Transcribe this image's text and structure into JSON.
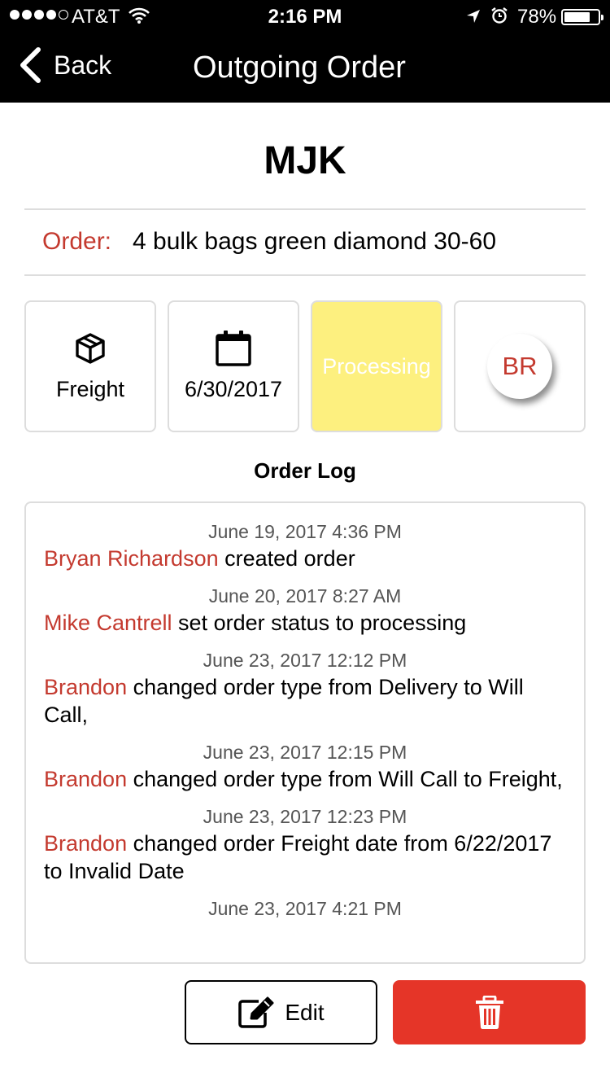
{
  "status_bar": {
    "carrier": "AT&T",
    "time": "2:16 PM",
    "battery": "78%",
    "signal_bars": 4,
    "signal_max": 5,
    "battery_level": 0.78
  },
  "nav": {
    "back_label": "Back",
    "title": "Outgoing Order"
  },
  "order": {
    "customer": "MJK",
    "label": "Order:",
    "description": "4 bulk bags green diamond 30-60"
  },
  "tiles": {
    "type_label": "Freight",
    "type_icon": "package-icon",
    "date": "6/30/2017",
    "date_icon": "calendar-icon",
    "status": "Processing",
    "status_color": "#fdf07f",
    "assignee_initials": "BR"
  },
  "log": {
    "title": "Order Log",
    "entries": [
      {
        "time": "June 19, 2017  4:36 PM",
        "who": "Bryan Richardson",
        "text": " created order"
      },
      {
        "time": "June 20, 2017  8:27 AM",
        "who": "Mike Cantrell",
        "text": " set order status to processing"
      },
      {
        "time": "June 23, 2017  12:12 PM",
        "who": "Brandon",
        "text": " changed order type from Delivery to Will Call,"
      },
      {
        "time": "June 23, 2017  12:15 PM",
        "who": "Brandon",
        "text": " changed order type from Will Call to Freight,"
      },
      {
        "time": "June 23, 2017  12:23 PM",
        "who": "Brandon",
        "text": " changed order Freight date from 6/22/2017 to Invalid Date"
      },
      {
        "time": "June 23, 2017  4:21 PM",
        "who": "",
        "text": ""
      }
    ]
  },
  "actions": {
    "edit_label": "Edit",
    "edit_icon": "edit-icon",
    "delete_icon": "trash-icon",
    "delete_color": "#e53528",
    "accent_color": "#c43a2f"
  }
}
